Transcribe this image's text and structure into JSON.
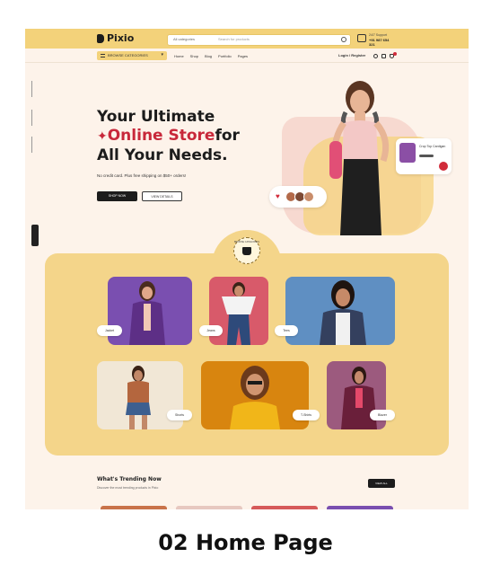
{
  "header": {
    "logo_text": "Pixio",
    "search_category": "All categories",
    "search_placeholder": "Search for products",
    "contact_label": "24/7 Support",
    "contact_phone": "+91 987 654 321"
  },
  "nav": {
    "browse_label": "BROWSE CATEGORIES",
    "links": [
      "Home",
      "Shop",
      "Blog",
      "Portfolio",
      "Pages"
    ],
    "login_label": "Login / Register"
  },
  "hero": {
    "title_line1": "Your Ultimate",
    "title_accent": "Online Store",
    "title_line2_suffix": "for",
    "title_line3": "All Your Needs.",
    "subtitle": "No credit card. Plus free shipping on $50+ orders!",
    "primary_button": "SHOP NOW",
    "secondary_button": "VIEW DETAILS",
    "product_card_text": "Crop Top Cardigan"
  },
  "categories": {
    "badge_text": "BROWSE CATEGORIES",
    "tiles": [
      {
        "label": "Jacket",
        "bg": "#7a4fb0"
      },
      {
        "label": "Jeans",
        "bg": "#d85a6a"
      },
      {
        "label": "Tees",
        "bg": "#5f8fc2"
      },
      {
        "label": "Shorts",
        "bg": "#f1e7d6"
      },
      {
        "label": "T-Shirts",
        "bg": "#d8850f"
      },
      {
        "label": "Blazer",
        "bg": "#9c5a7e"
      }
    ]
  },
  "trending": {
    "title": "What's Trending Now",
    "subtitle": "Discover the most trending products in Pixio",
    "button": "VIEW ALL"
  },
  "caption": "02 Home Page",
  "colors": {
    "accent_yellow": "#f3d27a",
    "accent_red": "#c8283a",
    "dark": "#1c1c1c",
    "page_bg": "#fdf3ea"
  }
}
